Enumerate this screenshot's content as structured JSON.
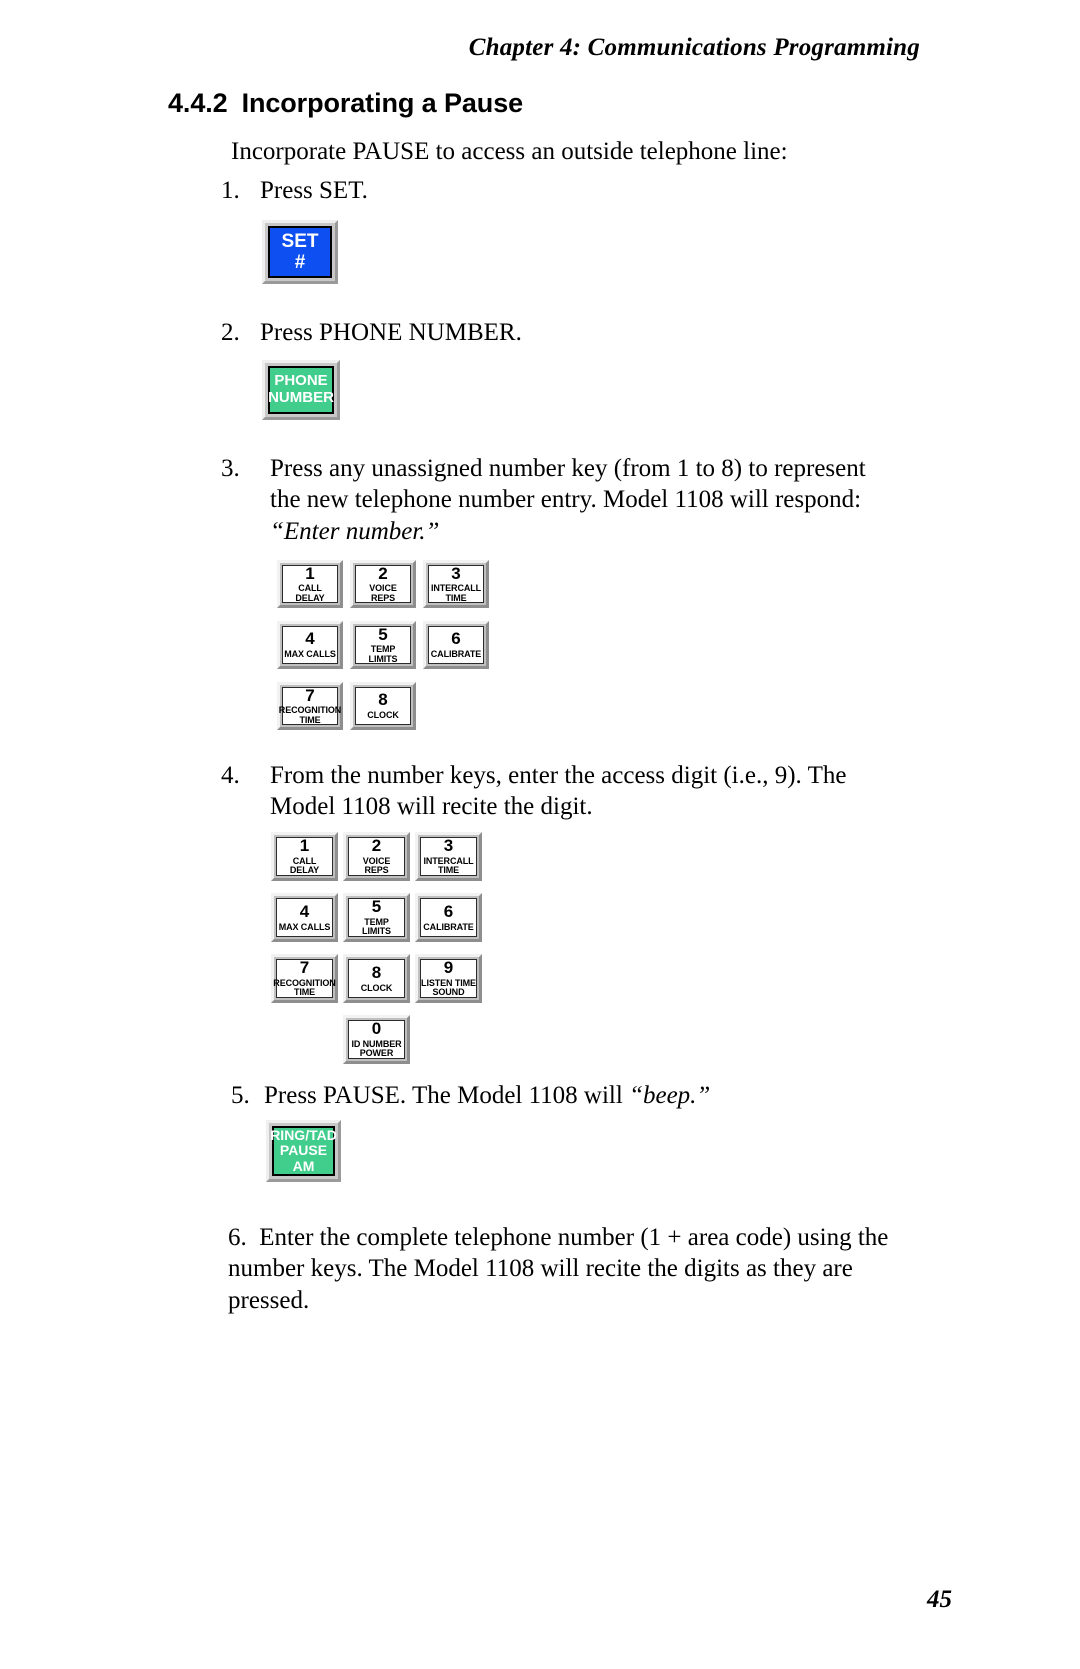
{
  "header": {
    "running_head": "Chapter 4:  Communications Programming"
  },
  "section": {
    "number": "4.4.2",
    "title": "Incorporating a Pause"
  },
  "intro": "Incorporate PAUSE to access an outside telephone line:",
  "steps": [
    {
      "marker": "1.",
      "text": "Press SET."
    },
    {
      "marker": "2.",
      "text": "Press PHONE NUMBER."
    },
    {
      "marker": "3.",
      "line1": "Press any unassigned number key (from 1 to  8) to represent",
      "line2": "the new telephone number entry. Model 1108 will respond:",
      "line3_italic": "“Enter number.”"
    },
    {
      "marker": "4.",
      "line1": "From the number keys, enter the access digit (i.e., 9). The",
      "line2": "Model 1108 will recite the digit."
    },
    {
      "marker": "5.",
      "text_before": "Press PAUSE. The Model 1108 will ",
      "text_italic": "“beep.”"
    },
    {
      "marker": "6.",
      "line1": "Enter the complete telephone number (1 + area code) using the",
      "line2": "number keys. The Model 1108 will recite the digits as they are",
      "line3": "pressed."
    }
  ],
  "keys": {
    "set": {
      "line1": "SET",
      "line2": "#",
      "color": "#0d4ff0"
    },
    "phone_number": {
      "line1": "PHONE",
      "line2": "NUMBER",
      "color": "#41cd8c"
    },
    "pause": {
      "line1": "RING/TAD",
      "line2": "PAUSE",
      "line3": "AM",
      "color": "#41cd8c"
    }
  },
  "keypad_a": {
    "rows": [
      [
        {
          "digit": "1",
          "label": "CALL\nDELAY"
        },
        {
          "digit": "2",
          "label": "VOICE\nREPS"
        },
        {
          "digit": "3",
          "label": "INTERCALL\nTIME"
        }
      ],
      [
        {
          "digit": "4",
          "label": "MAX CALLS"
        },
        {
          "digit": "5",
          "label": "TEMP LIMITS"
        },
        {
          "digit": "6",
          "label": "CALIBRATE"
        }
      ],
      [
        {
          "digit": "7",
          "label": "RECOGNITION\nTIME"
        },
        {
          "digit": "8",
          "label": "CLOCK"
        }
      ]
    ]
  },
  "keypad_b": {
    "rows": [
      [
        {
          "digit": "1",
          "label": "CALL\nDELAY"
        },
        {
          "digit": "2",
          "label": "VOICE\nREPS"
        },
        {
          "digit": "3",
          "label": "INTERCALL\nTIME"
        }
      ],
      [
        {
          "digit": "4",
          "label": "MAX CALLS"
        },
        {
          "digit": "5",
          "label": "TEMP LIMITS"
        },
        {
          "digit": "6",
          "label": "CALIBRATE"
        }
      ],
      [
        {
          "digit": "7",
          "label": "RECOGNITION\nTIME"
        },
        {
          "digit": "8",
          "label": "CLOCK"
        },
        {
          "digit": "9",
          "label": "LISTEN TIME\nSOUND"
        }
      ],
      [
        {
          "digit": "0",
          "label": "ID NUMBER\nPOWER"
        }
      ]
    ]
  },
  "footer": {
    "page_number": "45"
  }
}
